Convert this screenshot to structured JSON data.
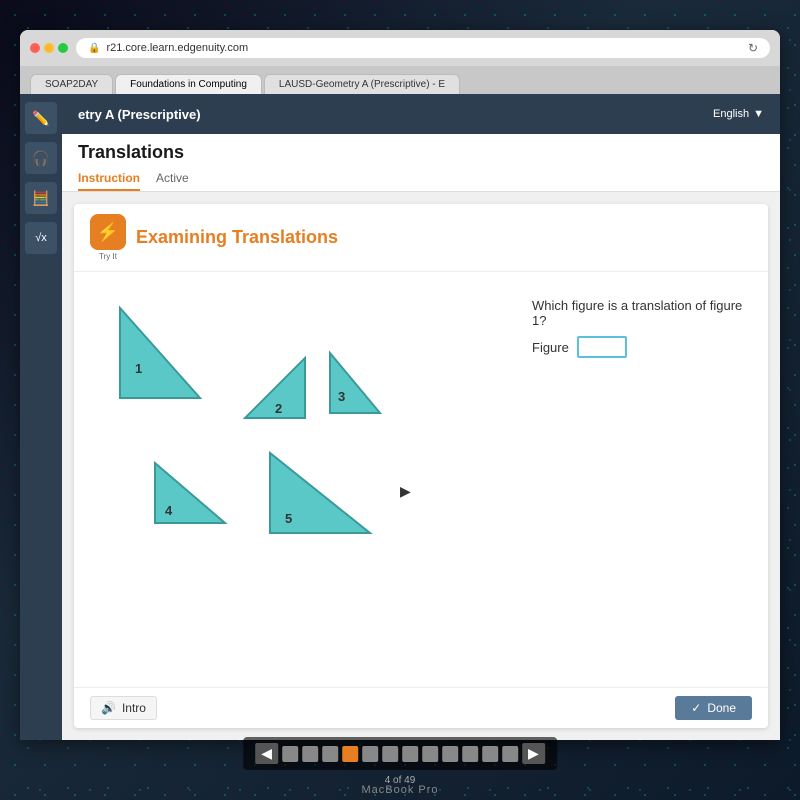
{
  "desktop": {
    "macbook_label": "MacBook Pro"
  },
  "browser": {
    "address": "r21.core.learn.edgenuity.com",
    "tabs": [
      {
        "label": "SOAP2DAY",
        "active": false
      },
      {
        "label": "Foundations in Computing",
        "active": true
      },
      {
        "label": "LAUSD-Geometry A (Prescriptive) - E",
        "active": false
      }
    ]
  },
  "app": {
    "course_title": "etry A (Prescriptive)",
    "language": "English",
    "lesson_title": "Translations",
    "tabs": [
      {
        "label": "Instruction",
        "active": true
      },
      {
        "label": "Active",
        "active": false
      }
    ]
  },
  "card": {
    "icon_label": "Try It",
    "title": "Examining Translations",
    "question": "Which figure is a translation of figure 1?",
    "figure_label": "Figure",
    "figure_input_value": "",
    "figures": [
      {
        "id": "1",
        "type": "large-right",
        "desc": "Large right triangle"
      },
      {
        "id": "2",
        "type": "medium-right-flipped",
        "desc": "Medium triangle tilted"
      },
      {
        "id": "3",
        "type": "medium-right",
        "desc": "Medium right triangle"
      },
      {
        "id": "4",
        "type": "medium-right2",
        "desc": "Medium right triangle bottom left"
      },
      {
        "id": "5",
        "type": "large-right-bottom",
        "desc": "Large right triangle bottom"
      }
    ],
    "intro_btn": "Intro",
    "done_btn": "Done"
  },
  "nav": {
    "page_info": "4 of 49",
    "dots": [
      {
        "active": false
      },
      {
        "active": false
      },
      {
        "active": false
      },
      {
        "active": true
      },
      {
        "active": false
      },
      {
        "active": false
      },
      {
        "active": false
      },
      {
        "active": false
      },
      {
        "active": false
      },
      {
        "active": false
      },
      {
        "active": false
      },
      {
        "active": false
      }
    ]
  }
}
